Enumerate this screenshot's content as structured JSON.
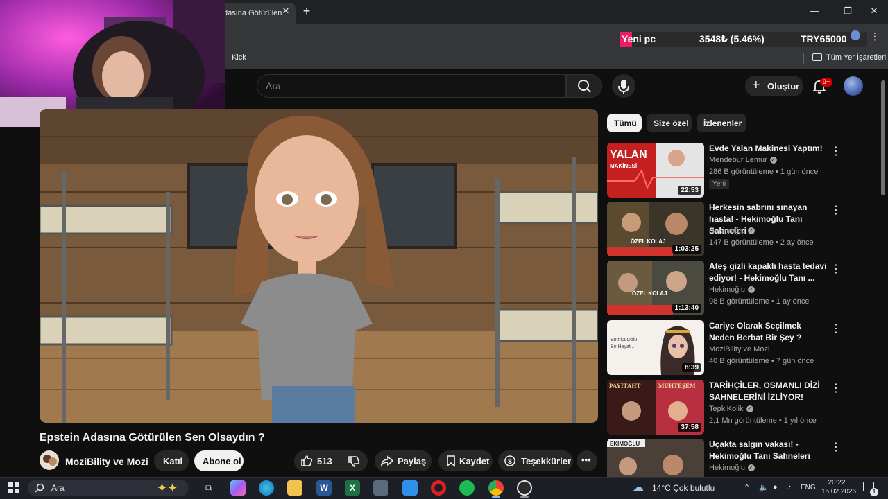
{
  "browser": {
    "tab_title": "dasına Götürülen",
    "tab_close": "✕",
    "new_tab": "+",
    "bookmark_kick": "Kick",
    "bookmark_all": "Tüm Yer İşaretleri"
  },
  "ticker": {
    "label": "Yeni pc",
    "value": "3548₺ (5.46%)",
    "currency": "TRY65000"
  },
  "header": {
    "search_placeholder": "Ara",
    "create_label": "Oluştur",
    "notification_count": "9+"
  },
  "video": {
    "title": "Epstein Adasına Götürülen Sen Olsaydın ?",
    "channel": "MoziBility ve Mozi",
    "join_label": "Katıl",
    "subscribe_label": "Abone ol",
    "likes": "513",
    "share_label": "Paylaş",
    "save_label": "Kaydet",
    "thanks_label": "Teşekkürler"
  },
  "chips": [
    {
      "label": "Tümü",
      "active": true
    },
    {
      "label": "Size özel",
      "active": false
    },
    {
      "label": "İzlenenler",
      "active": false
    }
  ],
  "recommendations": [
    {
      "title": "Evde Yalan Makinesi Yaptım!",
      "channel": "Mendebur Lemur",
      "meta": "286 B görüntüleme • 1 gün önce",
      "duration": "22:53",
      "badge": "Yeni",
      "thumb_text": "YALAN MAKİNESİ"
    },
    {
      "title": "Herkesin sabrını sınayan hasta! - Hekimoğlu Tanı Sahneleri",
      "channel": "Hekimoğlu",
      "meta": "147 B görüntüleme • 2 ay önce",
      "duration": "1:03:25",
      "thumb_text": "ÖZEL KOLAJ"
    },
    {
      "title": "Ateş gizli kapaklı hasta tedavi ediyor! - Hekimoğlu Tanı ...",
      "channel": "Hekimoğlu",
      "meta": "98 B görüntüleme • 1 ay önce",
      "duration": "1:13:40",
      "thumb_text": "ÖZEL KOLAJ"
    },
    {
      "title": "Cariye Olarak Seçilmek Neden Berbat Bir Şey ?",
      "channel": "MoziBility ve Mozi",
      "meta": "40 B görüntüleme • 7 gün önce",
      "duration": "8:39",
      "thumb_text": "Entrika Dolu Bir Hayat..."
    },
    {
      "title": "TARİHÇİLER, OSMANLI DİZİ SAHNELERİNİ İZLİYOR!",
      "channel": "TepkiKolik",
      "meta": "2,1 Mn görüntüleme • 1 yıl önce",
      "duration": "37:58",
      "thumb_text": "PAYİTAHT MUHTEŞEM"
    },
    {
      "title": "Uçakta salgın vakası! - Hekimoğlu Tanı Sahneleri",
      "channel": "Hekimoğlu",
      "meta": "",
      "duration": "",
      "thumb_text": "EKİMOĞLU"
    }
  ],
  "taskbar": {
    "search_label": "Ara",
    "weather": "14°C  Çok bulutlu",
    "lang": "ENG",
    "time": "20:22",
    "date": "15.02.2026",
    "notif_count": "1"
  }
}
